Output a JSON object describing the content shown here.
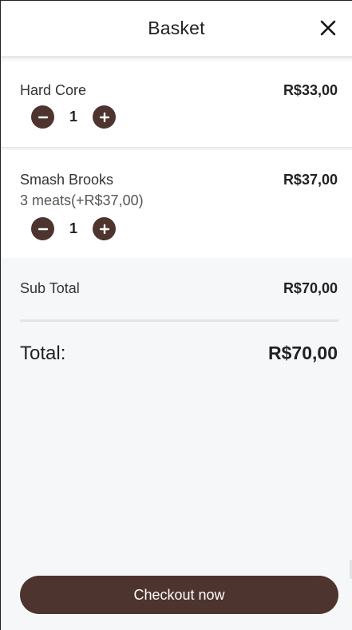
{
  "header": {
    "title": "Basket"
  },
  "items": [
    {
      "name": "Hard Core",
      "price": "R$33,00",
      "option": "",
      "quantity": "1"
    },
    {
      "name": "Smash Brooks",
      "price": "R$37,00",
      "option": "3 meats(+R$37,00)",
      "quantity": "1"
    }
  ],
  "summary": {
    "subtotal_label": "Sub Total",
    "subtotal_value": "R$70,00",
    "total_label": "Total:",
    "total_value": "R$70,00"
  },
  "checkout": {
    "label": "Checkout now"
  },
  "colors": {
    "accent": "#4e342e",
    "background": "#f6f7f9"
  },
  "icons": {
    "close": "close-icon",
    "minus": "minus-icon",
    "plus": "plus-icon"
  }
}
